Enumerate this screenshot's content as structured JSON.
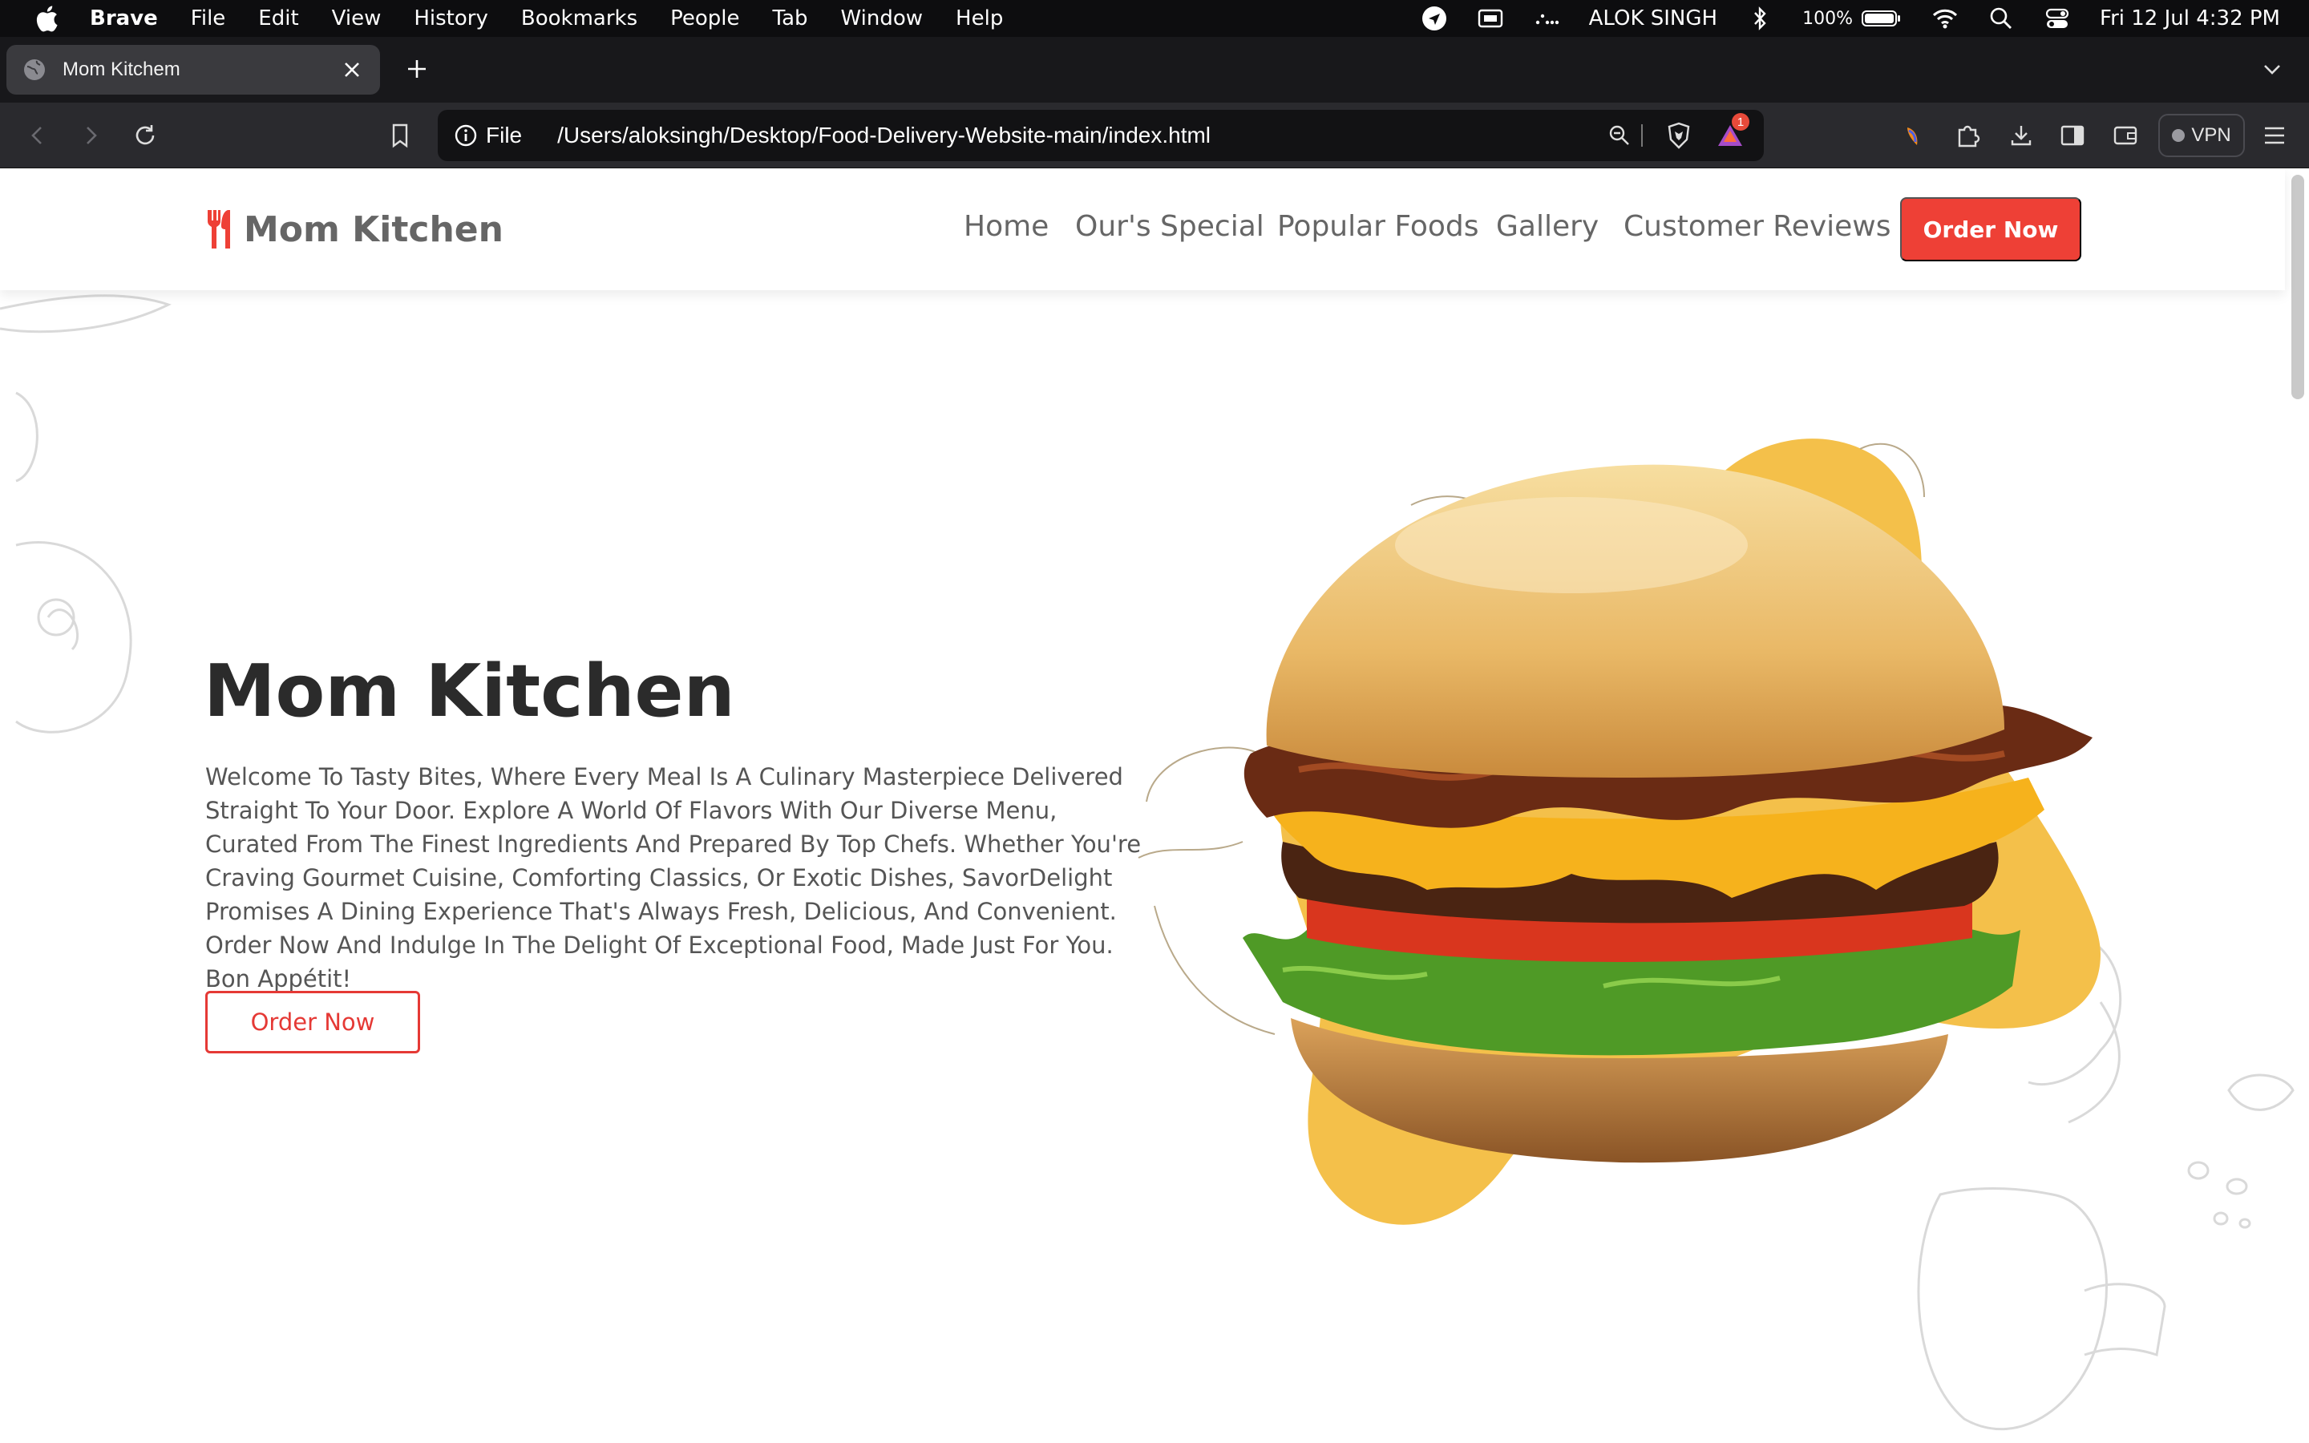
{
  "menubar": {
    "app": "Brave",
    "items": [
      "File",
      "Edit",
      "View",
      "History",
      "Bookmarks",
      "People",
      "Tab",
      "Window",
      "Help"
    ],
    "user": "ALOK SINGH",
    "battery": "100%",
    "datetime": "Fri 12 Jul  4:32 PM"
  },
  "browser": {
    "tab_title": "Mom Kitchem",
    "url_scheme": "File",
    "url_path": "/Users/aloksingh/Desktop/Food-Delivery-Website-main/index.html",
    "rewards_badge": "1",
    "vpn_label": "VPN"
  },
  "site": {
    "logo_text": "Mom Kitchen",
    "nav": [
      "Home",
      "Our's Special",
      "Popular Foods",
      "Gallery",
      "Customer Reviews"
    ],
    "header_cta": "Order Now",
    "hero_title": "Mom Kitchen",
    "hero_text": "Welcome To Tasty Bites, Where Every Meal Is A Culinary Masterpiece Delivered Straight To Your Door. Explore A World Of Flavors With Our Diverse Menu, Curated From The Finest Ingredients And Prepared By Top Chefs. Whether You're Craving Gourmet Cuisine, Comforting Classics, Or Exotic Dishes, SavorDelight Promises A Dining Experience That's Always Fresh, Delicious, And Convenient. Order Now And Indulge In The Delight Of Exceptional Food, Made Just For You. Bon Appétit!",
    "hero_button": "Order Now",
    "colors": {
      "accent": "#ee4036",
      "blob": "#f4c04a",
      "text_dark": "#2b2b2b",
      "text_muted": "#555555"
    }
  }
}
